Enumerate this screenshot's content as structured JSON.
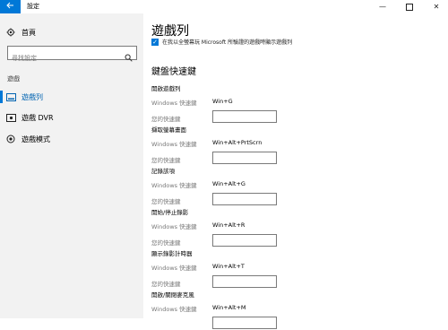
{
  "titlebar": {
    "title": "設定",
    "back_icon": "arrow-left",
    "min_glyph": "—",
    "close_glyph": "✕"
  },
  "sidebar": {
    "home_label": "首頁",
    "search_placeholder": "尋找設定",
    "section_label": "遊戲",
    "items": [
      {
        "label": "遊戲列",
        "icon": "game-bar-icon",
        "active": true
      },
      {
        "label": "遊戲 DVR",
        "icon": "dvr-icon",
        "active": false
      },
      {
        "label": "遊戲模式",
        "icon": "game-mode-icon",
        "active": false
      }
    ]
  },
  "main": {
    "title": "遊戲列",
    "checkbox_label": "在我以全螢幕玩 Microsoft 所驗證的遊戲時顯示遊戲列",
    "section_title": "鍵盤快速鍵",
    "windows_label": "Windows 快速鍵",
    "your_label": "您的快速鍵",
    "shortcuts": [
      {
        "name": "開啟遊戲列",
        "windows": "Win+G",
        "custom": ""
      },
      {
        "name": "擷取螢幕畫面",
        "windows": "Win+Alt+PrtScrn",
        "custom": ""
      },
      {
        "name": "記錄該項",
        "windows": "Win+Alt+G",
        "custom": ""
      },
      {
        "name": "開始/停止錄影",
        "windows": "Win+Alt+R",
        "custom": ""
      },
      {
        "name": "顯示錄影計時器",
        "windows": "Win+Alt+T",
        "custom": ""
      },
      {
        "name": "開啟/關閉麥克風",
        "windows": "Win+Alt+M",
        "custom": ""
      }
    ]
  },
  "colors": {
    "accent": "#0078d7",
    "sidebar_bg": "#f2f2f2"
  }
}
